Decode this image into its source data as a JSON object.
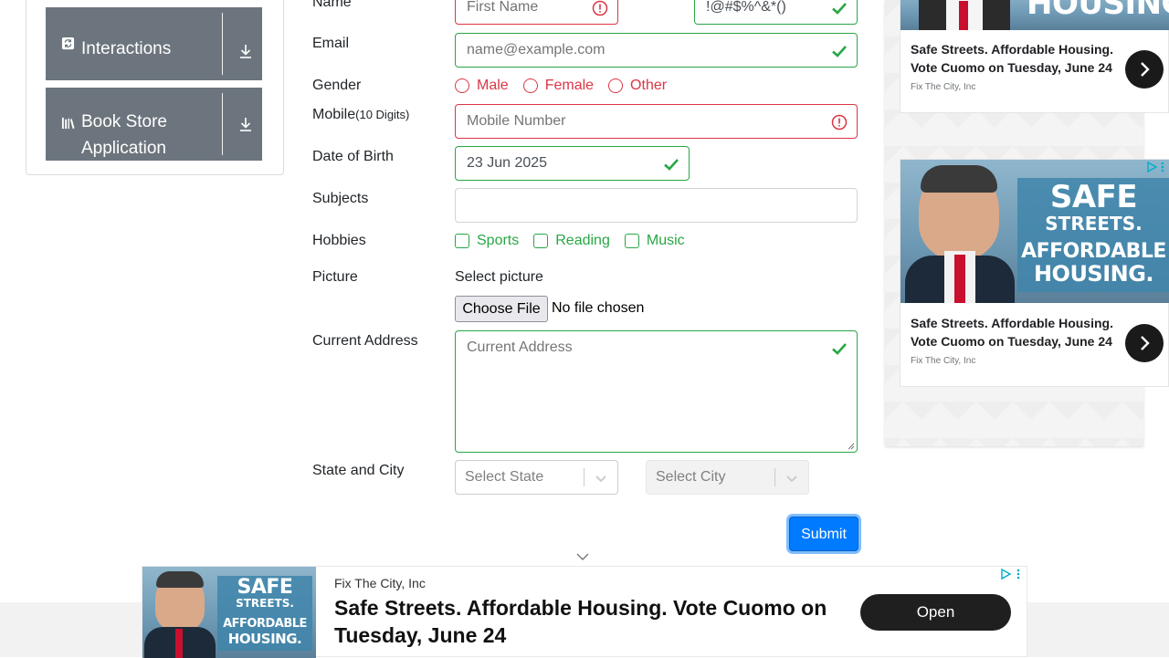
{
  "sidebar": {
    "groups": [
      {
        "label": "Interactions",
        "icon": "refresh-icon"
      },
      {
        "label": "Book Store Application",
        "icon": "books-icon"
      }
    ]
  },
  "form": {
    "name_label": "Name",
    "first_name_placeholder": "First Name",
    "last_name_value": "!@#$%^&*()",
    "email_label": "Email",
    "email_placeholder": "name@example.com",
    "gender_label": "Gender",
    "gender_options": [
      "Male",
      "Female",
      "Other"
    ],
    "mobile_label": "Mobile",
    "mobile_hint": "(10 Digits)",
    "mobile_placeholder": "Mobile Number",
    "dob_label": "Date of Birth",
    "dob_value": "23 Jun 2025",
    "subjects_label": "Subjects",
    "hobbies_label": "Hobbies",
    "hobby_options": [
      "Sports",
      "Reading",
      "Music"
    ],
    "picture_label": "Picture",
    "select_picture_text": "Select picture",
    "choose_file_label": "Choose File",
    "file_status": "No file chosen",
    "address_label": "Current Address",
    "address_placeholder": "Current Address",
    "state_city_label": "State and City",
    "state_placeholder": "Select State",
    "city_placeholder": "Select City",
    "submit_label": "Submit"
  },
  "ads": {
    "image_headline_1": "SAFE",
    "image_headline_2": "STREETS.",
    "image_headline_3": "AFFORDABLE",
    "image_headline_4": "HOUSING.",
    "headline": "Safe Streets. Affordable Housing. Vote Cuomo on Tuesday, June 24",
    "advertiser": "Fix The City, Inc",
    "bottom_advertiser": "Fix The City, Inc",
    "bottom_headline": "Safe Streets. Affordable Housing. Vote Cuomo on Tuesday, June 24",
    "open_label": "Open"
  },
  "colors": {
    "valid": "#28a745",
    "invalid": "#dc3545",
    "primary": "#007bff",
    "sidebar_group": "#6c757d"
  }
}
